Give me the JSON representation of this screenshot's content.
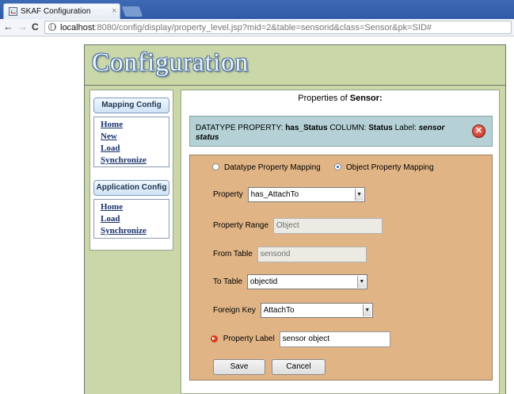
{
  "browser": {
    "tab_title": "SKAF Configuration",
    "tab_close": "×",
    "url_host": "localhost",
    "url_rest": ":8080/config/display/property_level.jsp?mid=2&table=sensorid&class=Sensor&pk=SID#",
    "nav": {
      "back": "←",
      "forward": "→",
      "reload": "C"
    }
  },
  "banner": {
    "title": "Configuration"
  },
  "sidebar": {
    "mapping_header": "Mapping Config",
    "mapping_links": [
      "Home",
      "New",
      "Load",
      "Synchronize"
    ],
    "app_header": "Application Config",
    "app_links": [
      "Home",
      "Load",
      "Synchronize"
    ]
  },
  "main": {
    "title_prefix": "Properties of",
    "title_class": "Sensor:",
    "info": {
      "prefix": "DATATYPE PROPERTY:",
      "property": "has_Status",
      "column_label": "COLUMN:",
      "column": "Status",
      "label_label": "Label:",
      "label": "sensor status",
      "close": "✕"
    },
    "form": {
      "radio_datatype": "Datatype Property Mapping",
      "radio_object": "Object Property Mapping",
      "selected_mapping": "Object Property Mapping",
      "property_label": "Property",
      "property_value": "has_AttachTo",
      "range_label": "Property Range",
      "range_value": "Object",
      "from_table_label": "From Table",
      "from_table_value": "sensorid",
      "to_table_label": "To Table",
      "to_table_value": "objectid",
      "foreign_key_label": "Foreign Key",
      "foreign_key_value": "AttachTo",
      "prop_label_label": "Property Label",
      "prop_label_value": "sensor object",
      "save": "Save",
      "cancel": "Cancel",
      "arrow": "▼"
    }
  },
  "colors": {
    "page_bg": "#cad7a9",
    "info_bg": "#b5d1d5",
    "form_bg": "#e0b485",
    "link": "#17306b",
    "tabstrip": "#2f5aa6"
  }
}
